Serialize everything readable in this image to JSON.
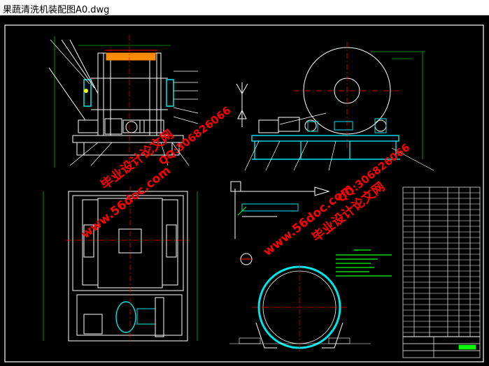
{
  "window": {
    "title": "果蔬清洗机装配图A0.dwg"
  },
  "drawing": {
    "background": "#000000",
    "line_white": "#ffffff",
    "line_red": "#ff0000",
    "line_cyan": "#00e5e5",
    "line_green": "#00ff00",
    "line_orange": "#ff8c00",
    "watermark_color": "#ff0000",
    "watermarks": {
      "site_1": "www.56doc.com",
      "qq_1": "QQ:306826066",
      "brand_1": "毕业设计论文网",
      "site_2": "www.56doc.com",
      "qq_2": "QQ:306826066",
      "brand_2": "毕业设计论文网"
    }
  }
}
